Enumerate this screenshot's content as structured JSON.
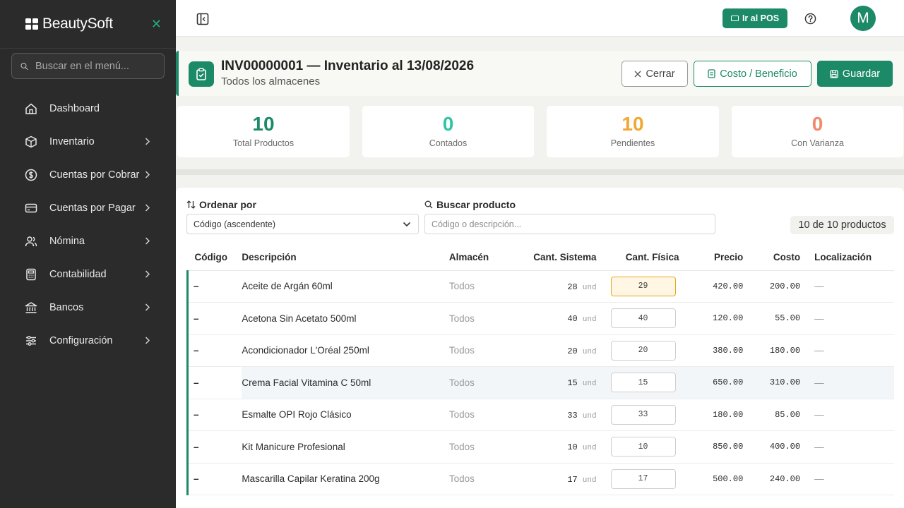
{
  "brand": {
    "name": "BeautySoft"
  },
  "sidebar": {
    "search_placeholder": "Buscar en el menú...",
    "items": [
      {
        "label": "Dashboard",
        "icon": "home-icon",
        "chevron": false
      },
      {
        "label": "Inventario",
        "icon": "box-icon",
        "chevron": true
      },
      {
        "label": "Cuentas por Cobrar",
        "icon": "dollar-icon",
        "chevron": true
      },
      {
        "label": "Cuentas por Pagar",
        "icon": "card-icon",
        "chevron": true
      },
      {
        "label": "Nómina",
        "icon": "users-icon",
        "chevron": true
      },
      {
        "label": "Contabilidad",
        "icon": "calculator-icon",
        "chevron": true
      },
      {
        "label": "Bancos",
        "icon": "bank-icon",
        "chevron": true
      },
      {
        "label": "Configuración",
        "icon": "sliders-icon",
        "chevron": true
      }
    ]
  },
  "topbar": {
    "pos_label": "Ir al POS",
    "avatar_initial": "M"
  },
  "document": {
    "title": "INV00000001 — Inventario al 13/08/2026",
    "subtitle": "Todos los almacenes",
    "close_label": "Cerrar",
    "cost_label": "Costo / Beneficio",
    "save_label": "Guardar"
  },
  "stats": [
    {
      "value": "10",
      "label": "Total Productos",
      "color": "#1d8a67"
    },
    {
      "value": "0",
      "label": "Contados",
      "color": "#2ec4a6"
    },
    {
      "value": "10",
      "label": "Pendientes",
      "color": "#f0a830"
    },
    {
      "value": "0",
      "label": "Con Varianza",
      "color": "#ef8a6a"
    }
  ],
  "filters": {
    "sort_label": "Ordenar por",
    "sort_value": "Código (ascendente)",
    "search_label": "Buscar producto",
    "search_placeholder": "Código o descripción...",
    "count_text": "10 de 10 productos"
  },
  "table": {
    "columns": [
      "Código",
      "Descripción",
      "Almacén",
      "Cant. Sistema",
      "Cant. Física",
      "Precio",
      "Costo",
      "Localización"
    ],
    "unit": "und",
    "rows": [
      {
        "code": "–",
        "desc": "Aceite de Argán 60ml",
        "alm": "Todos",
        "sys": "28",
        "fis": "29",
        "price": "420.00",
        "cost": "200.00",
        "loc": "—"
      },
      {
        "code": "–",
        "desc": "Acetona Sin Acetato 500ml",
        "alm": "Todos",
        "sys": "40",
        "fis": "40",
        "price": "120.00",
        "cost": "55.00",
        "loc": "—"
      },
      {
        "code": "–",
        "desc": "Acondicionador L'Oréal 250ml",
        "alm": "Todos",
        "sys": "20",
        "fis": "20",
        "price": "380.00",
        "cost": "180.00",
        "loc": "—"
      },
      {
        "code": "–",
        "desc": "Crema Facial Vitamina C 50ml",
        "alm": "Todos",
        "sys": "15",
        "fis": "15",
        "price": "650.00",
        "cost": "310.00",
        "loc": "—"
      },
      {
        "code": "–",
        "desc": "Esmalte OPI Rojo Clásico",
        "alm": "Todos",
        "sys": "33",
        "fis": "33",
        "price": "180.00",
        "cost": "85.00",
        "loc": "—"
      },
      {
        "code": "–",
        "desc": "Kit Manicure Profesional",
        "alm": "Todos",
        "sys": "10",
        "fis": "10",
        "price": "850.00",
        "cost": "400.00",
        "loc": "—"
      },
      {
        "code": "–",
        "desc": "Mascarilla Capilar Keratina 200g",
        "alm": "Todos",
        "sys": "17",
        "fis": "17",
        "price": "500.00",
        "cost": "240.00",
        "loc": "—"
      }
    ]
  }
}
